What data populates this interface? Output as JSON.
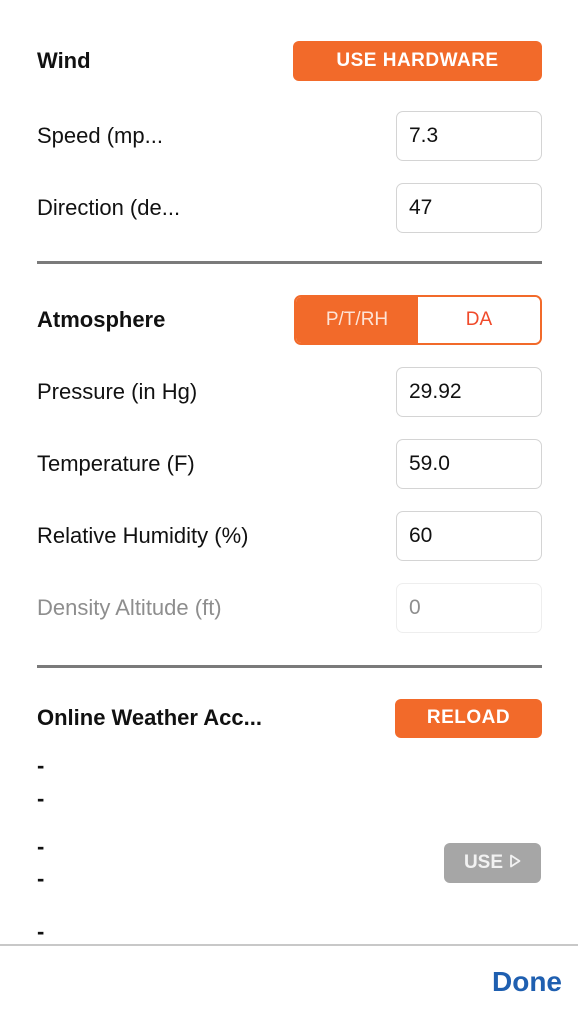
{
  "wind": {
    "title": "Wind",
    "hardware_button": "USE HARDWARE",
    "speed_label": "Speed (mp...",
    "speed_value": "7.3",
    "direction_label": "Direction (de...",
    "direction_value": "47"
  },
  "atmosphere": {
    "title": "Atmosphere",
    "segments": [
      {
        "label": "P/T/RH",
        "active": true
      },
      {
        "label": "DA",
        "active": false
      }
    ],
    "pressure_label": "Pressure (in Hg)",
    "pressure_value": "29.92",
    "temperature_label": "Temperature (F)",
    "temperature_value": "59.0",
    "humidity_label": "Relative Humidity (%)",
    "humidity_value": "60",
    "density_altitude_label": "Density Altitude (ft)",
    "density_altitude_value": "0"
  },
  "online_weather": {
    "title": "Online Weather Acc...",
    "reload_button": "RELOAD",
    "lines": [
      "-",
      "-",
      "-",
      "-",
      "-"
    ],
    "use_button": "USE",
    "use_icon": "play-outline-icon"
  },
  "footer": {
    "done_label": "Done"
  },
  "colors": {
    "accent": "#f26a2a",
    "disabled_button": "#a6a6a6",
    "link": "#1f5fb0"
  }
}
